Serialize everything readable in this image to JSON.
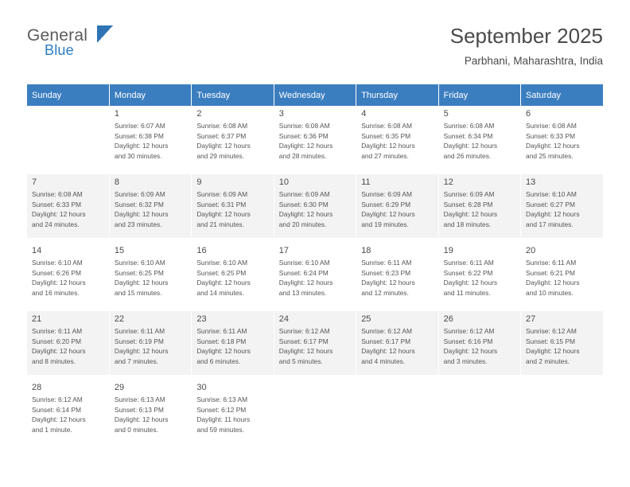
{
  "logo": {
    "word1": "General",
    "word2": "Blue",
    "flag_icon": "flag-icon"
  },
  "header": {
    "title": "September 2025",
    "subtitle": "Parbhani, Maharashtra, India"
  },
  "colors": {
    "header_bar": "#3b7ec0",
    "alt_row": "#f3f3f3",
    "brand_blue": "#2b7cc4",
    "text": "#4a4a4a"
  },
  "calendar": {
    "weekday_headers": [
      "Sunday",
      "Monday",
      "Tuesday",
      "Wednesday",
      "Thursday",
      "Friday",
      "Saturday"
    ],
    "weeks": [
      [
        {
          "day": "",
          "lines": []
        },
        {
          "day": "1",
          "lines": [
            "Sunrise: 6:07 AM",
            "Sunset: 6:38 PM",
            "Daylight: 12 hours",
            "and 30 minutes."
          ]
        },
        {
          "day": "2",
          "lines": [
            "Sunrise: 6:08 AM",
            "Sunset: 6:37 PM",
            "Daylight: 12 hours",
            "and 29 minutes."
          ]
        },
        {
          "day": "3",
          "lines": [
            "Sunrise: 6:08 AM",
            "Sunset: 6:36 PM",
            "Daylight: 12 hours",
            "and 28 minutes."
          ]
        },
        {
          "day": "4",
          "lines": [
            "Sunrise: 6:08 AM",
            "Sunset: 6:35 PM",
            "Daylight: 12 hours",
            "and 27 minutes."
          ]
        },
        {
          "day": "5",
          "lines": [
            "Sunrise: 6:08 AM",
            "Sunset: 6:34 PM",
            "Daylight: 12 hours",
            "and 26 minutes."
          ]
        },
        {
          "day": "6",
          "lines": [
            "Sunrise: 6:08 AM",
            "Sunset: 6:33 PM",
            "Daylight: 12 hours",
            "and 25 minutes."
          ]
        }
      ],
      [
        {
          "day": "7",
          "lines": [
            "Sunrise: 6:08 AM",
            "Sunset: 6:33 PM",
            "Daylight: 12 hours",
            "and 24 minutes."
          ]
        },
        {
          "day": "8",
          "lines": [
            "Sunrise: 6:09 AM",
            "Sunset: 6:32 PM",
            "Daylight: 12 hours",
            "and 23 minutes."
          ]
        },
        {
          "day": "9",
          "lines": [
            "Sunrise: 6:09 AM",
            "Sunset: 6:31 PM",
            "Daylight: 12 hours",
            "and 21 minutes."
          ]
        },
        {
          "day": "10",
          "lines": [
            "Sunrise: 6:09 AM",
            "Sunset: 6:30 PM",
            "Daylight: 12 hours",
            "and 20 minutes."
          ]
        },
        {
          "day": "11",
          "lines": [
            "Sunrise: 6:09 AM",
            "Sunset: 6:29 PM",
            "Daylight: 12 hours",
            "and 19 minutes."
          ]
        },
        {
          "day": "12",
          "lines": [
            "Sunrise: 6:09 AM",
            "Sunset: 6:28 PM",
            "Daylight: 12 hours",
            "and 18 minutes."
          ]
        },
        {
          "day": "13",
          "lines": [
            "Sunrise: 6:10 AM",
            "Sunset: 6:27 PM",
            "Daylight: 12 hours",
            "and 17 minutes."
          ]
        }
      ],
      [
        {
          "day": "14",
          "lines": [
            "Sunrise: 6:10 AM",
            "Sunset: 6:26 PM",
            "Daylight: 12 hours",
            "and 16 minutes."
          ]
        },
        {
          "day": "15",
          "lines": [
            "Sunrise: 6:10 AM",
            "Sunset: 6:25 PM",
            "Daylight: 12 hours",
            "and 15 minutes."
          ]
        },
        {
          "day": "16",
          "lines": [
            "Sunrise: 6:10 AM",
            "Sunset: 6:25 PM",
            "Daylight: 12 hours",
            "and 14 minutes."
          ]
        },
        {
          "day": "17",
          "lines": [
            "Sunrise: 6:10 AM",
            "Sunset: 6:24 PM",
            "Daylight: 12 hours",
            "and 13 minutes."
          ]
        },
        {
          "day": "18",
          "lines": [
            "Sunrise: 6:11 AM",
            "Sunset: 6:23 PM",
            "Daylight: 12 hours",
            "and 12 minutes."
          ]
        },
        {
          "day": "19",
          "lines": [
            "Sunrise: 6:11 AM",
            "Sunset: 6:22 PM",
            "Daylight: 12 hours",
            "and 11 minutes."
          ]
        },
        {
          "day": "20",
          "lines": [
            "Sunrise: 6:11 AM",
            "Sunset: 6:21 PM",
            "Daylight: 12 hours",
            "and 10 minutes."
          ]
        }
      ],
      [
        {
          "day": "21",
          "lines": [
            "Sunrise: 6:11 AM",
            "Sunset: 6:20 PM",
            "Daylight: 12 hours",
            "and 8 minutes."
          ]
        },
        {
          "day": "22",
          "lines": [
            "Sunrise: 6:11 AM",
            "Sunset: 6:19 PM",
            "Daylight: 12 hours",
            "and 7 minutes."
          ]
        },
        {
          "day": "23",
          "lines": [
            "Sunrise: 6:11 AM",
            "Sunset: 6:18 PM",
            "Daylight: 12 hours",
            "and 6 minutes."
          ]
        },
        {
          "day": "24",
          "lines": [
            "Sunrise: 6:12 AM",
            "Sunset: 6:17 PM",
            "Daylight: 12 hours",
            "and 5 minutes."
          ]
        },
        {
          "day": "25",
          "lines": [
            "Sunrise: 6:12 AM",
            "Sunset: 6:17 PM",
            "Daylight: 12 hours",
            "and 4 minutes."
          ]
        },
        {
          "day": "26",
          "lines": [
            "Sunrise: 6:12 AM",
            "Sunset: 6:16 PM",
            "Daylight: 12 hours",
            "and 3 minutes."
          ]
        },
        {
          "day": "27",
          "lines": [
            "Sunrise: 6:12 AM",
            "Sunset: 6:15 PM",
            "Daylight: 12 hours",
            "and 2 minutes."
          ]
        }
      ],
      [
        {
          "day": "28",
          "lines": [
            "Sunrise: 6:12 AM",
            "Sunset: 6:14 PM",
            "Daylight: 12 hours",
            "and 1 minute."
          ]
        },
        {
          "day": "29",
          "lines": [
            "Sunrise: 6:13 AM",
            "Sunset: 6:13 PM",
            "Daylight: 12 hours",
            "and 0 minutes."
          ]
        },
        {
          "day": "30",
          "lines": [
            "Sunrise: 6:13 AM",
            "Sunset: 6:12 PM",
            "Daylight: 11 hours",
            "and 59 minutes."
          ]
        },
        {
          "day": "",
          "lines": []
        },
        {
          "day": "",
          "lines": []
        },
        {
          "day": "",
          "lines": []
        },
        {
          "day": "",
          "lines": []
        }
      ]
    ]
  }
}
